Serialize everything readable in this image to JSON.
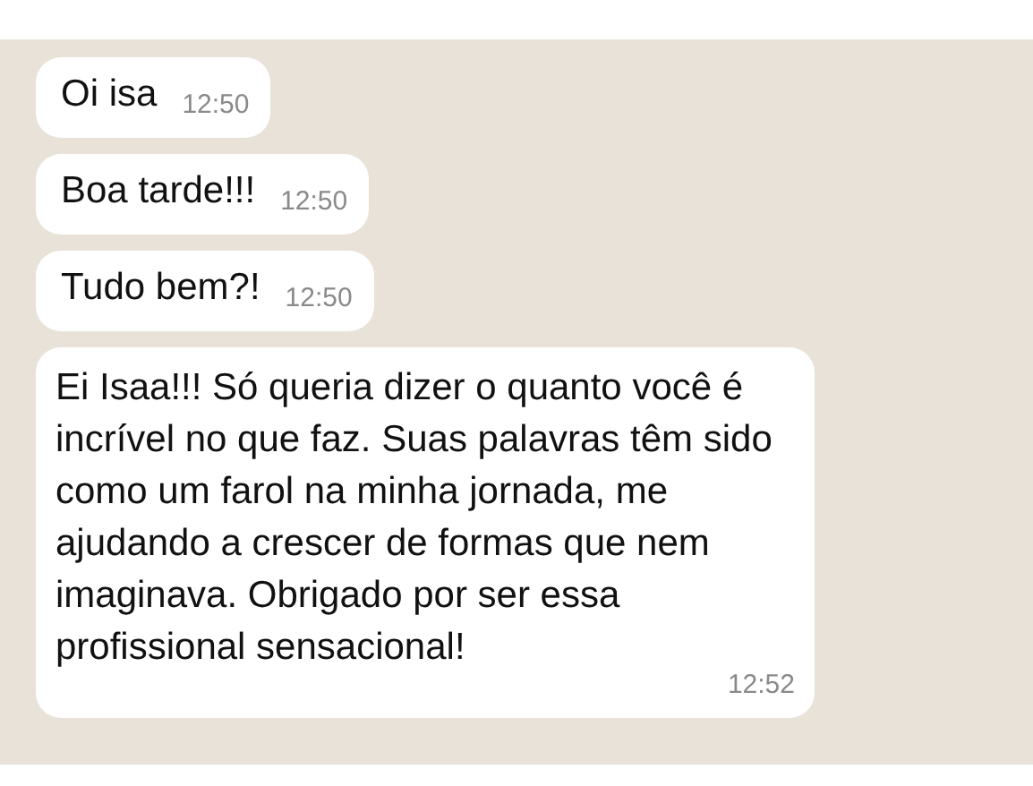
{
  "messages": [
    {
      "text": "Oi isa",
      "time": "12:50"
    },
    {
      "text": "Boa tarde!!!",
      "time": "12:50"
    },
    {
      "text": "Tudo bem?!",
      "time": "12:50"
    },
    {
      "text": "Ei Isaa!!! Só queria dizer o quanto você é incrível no que faz. Suas palavras têm sido como um farol na minha jornada, me ajudando a crescer de formas que nem imaginava. Obrigado por ser essa profissional sensacional!",
      "time": "12:52"
    }
  ]
}
